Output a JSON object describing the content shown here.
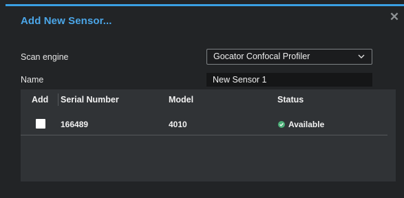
{
  "dialog": {
    "title": "Add New Sensor...",
    "close_glyph": "✕",
    "accent_color": "#3aa0e4"
  },
  "form": {
    "scan_engine_label": "Scan engine",
    "scan_engine_value": "Gocator Confocal Profiler",
    "name_label": "Name",
    "name_value": "New Sensor 1"
  },
  "table": {
    "headers": {
      "add": "Add",
      "serial": "Serial Number",
      "model": "Model",
      "status": "Status"
    },
    "rows": [
      {
        "checked": false,
        "serial": "166489",
        "model": "4010",
        "status": "Available",
        "status_icon": "check-circle-icon",
        "status_color": "#4caf78"
      }
    ]
  }
}
